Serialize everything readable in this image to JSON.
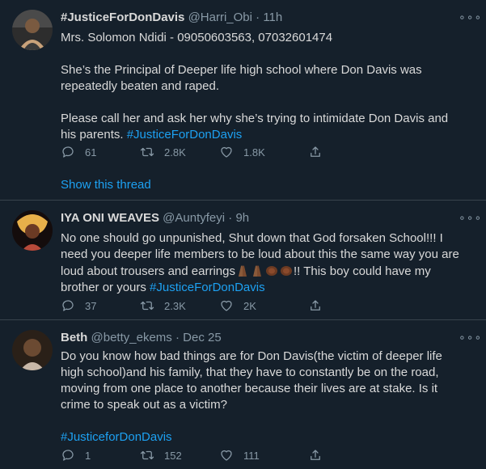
{
  "tweets": [
    {
      "name": "#JusticeForDonDavis",
      "handle": "@Harri_Obi",
      "time": "11h",
      "lines": [
        "Mrs. Solomon Ndidi - 09050603563, 07032601474",
        "",
        "She’s the Principal of Deeper life high school where Don Davis was",
        "repeatedly beaten and raped.",
        "",
        "Please call her and ask her why she’s trying to intimidate Don Davis and"
      ],
      "last_line_prefix": "his parents. ",
      "hashtag": "#JusticeForDonDavis",
      "replies": "61",
      "retweets": "2.8K",
      "likes": "1.8K",
      "show_thread": "Show this thread",
      "avatar_colors": [
        "#3a3a3a",
        "#7a5a40",
        "#c9a27a"
      ]
    },
    {
      "name": "IYA ONI WEAVES",
      "handle": "@Auntyfeyi",
      "time": "9h",
      "lines": [
        "No one should go unpunished, Shut down that God forsaken School!!! I",
        "need you deeper life members to be loud about this the same way you are"
      ],
      "line3_prefix": "loud about trousers and earrings",
      "line3_suffix": "!! This boy could have my",
      "line4_prefix": "brother or yours ",
      "hashtag": "#JusticeForDonDavis",
      "replies": "37",
      "retweets": "2.3K",
      "likes": "2K",
      "avatar_colors": [
        "#1a1010",
        "#b84a3a",
        "#e8b04a"
      ]
    },
    {
      "name": "Beth",
      "handle": "@betty_ekems",
      "time": "Dec 25",
      "lines": [
        "Do you know how bad things are for Don Davis(the victim of deeper life",
        "high school)and his family, that they have to constantly be on the road,",
        "moving from one place to another because their lives are at stake. Is it",
        "crime to speak out as a victim?"
      ],
      "line4_full": "crime to speak out as a victim?",
      "hashtag": "#JusticeforDonDavis",
      "replies": "1",
      "retweets": "152",
      "likes": "111",
      "avatar_colors": [
        "#2a2018",
        "#6b4a32",
        "#c9b8a8"
      ]
    }
  ],
  "separator": " · ",
  "more_glyph": "∘∘∘"
}
